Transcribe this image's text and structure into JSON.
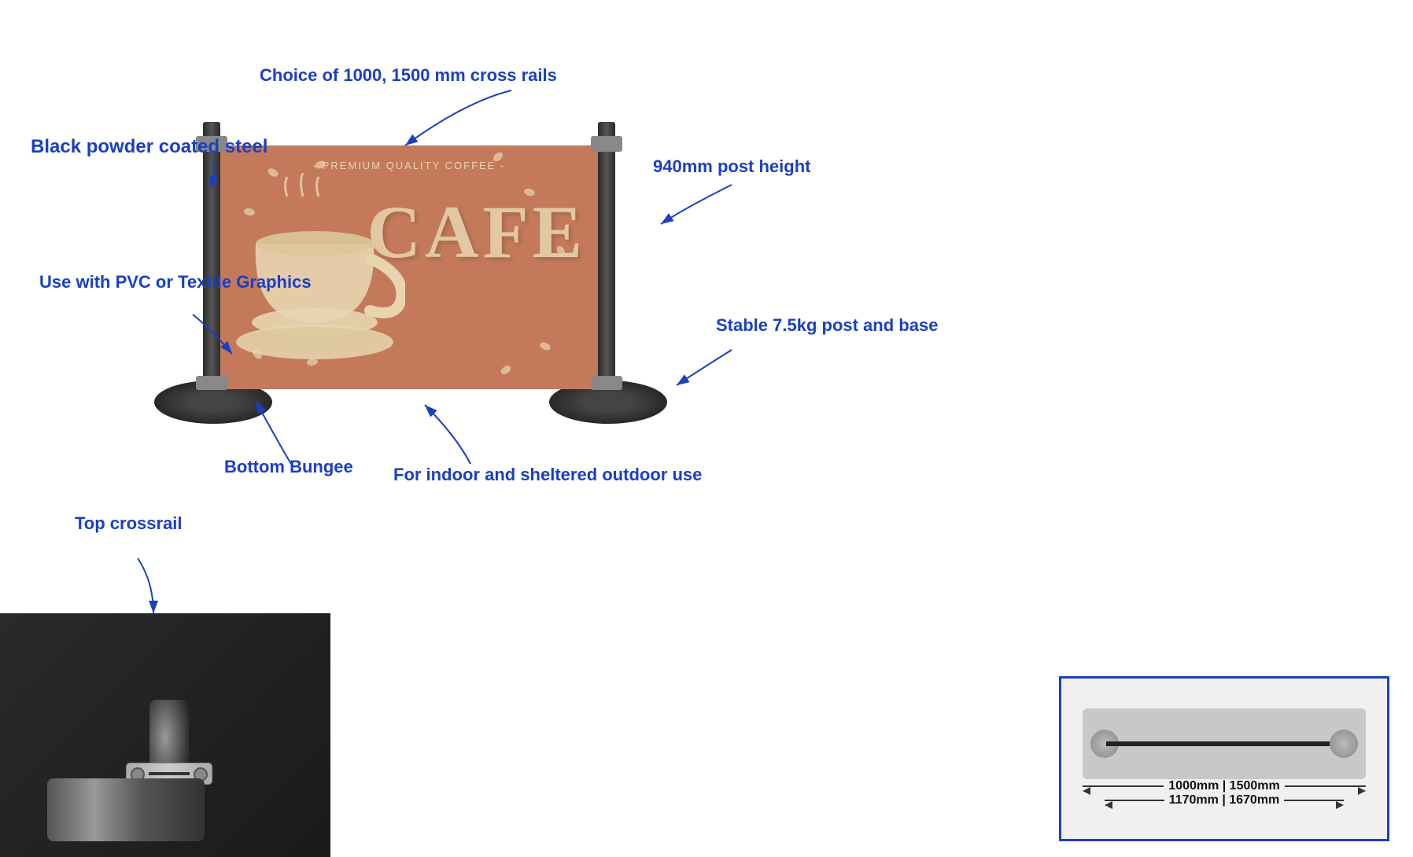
{
  "annotations": {
    "cross_rails": "Choice of 1000, 1500 mm cross rails",
    "black_powder": "Black powder coated steel",
    "post_height": "940mm post height",
    "pvc_textile": "Use with PVC or\nTextile Graphics",
    "stable": "Stable 7.5kg\npost and base",
    "bottom_bungee": "Bottom Bungee",
    "indoor_outdoor": "For indoor and sheltered\noutdoor use",
    "top_crossrail": "Top crossrail"
  },
  "diagram": {
    "label1": "1000mm | 1500mm",
    "label2": "1170mm | 1670mm"
  },
  "banner": {
    "top_text": "- PREMIUM QUALITY COFFEE -",
    "main_text": "CAFE"
  }
}
